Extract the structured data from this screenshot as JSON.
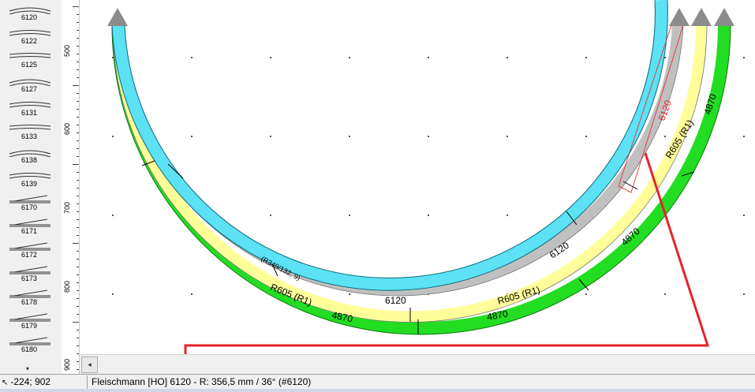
{
  "palette": {
    "items": [
      "6120",
      "6122",
      "6125",
      "6127",
      "6131",
      "6133",
      "6138",
      "6139",
      "6170",
      "6171",
      "6172",
      "6173",
      "6178",
      "6179",
      "6180"
    ]
  },
  "ruler": {
    "labels": [
      "500",
      "600",
      "700",
      "800",
      "900"
    ]
  },
  "canvas": {
    "labels": {
      "inner_track": "(R349/132, 9)",
      "gray_track_top": "6120",
      "gray_track_bottom": "6120",
      "gray_track_mid": "6120",
      "yellow_track_left": "R605 (R1)",
      "yellow_track_right": "R605 (R1)",
      "yellow_track_top": "R605 (R1)",
      "green_track_left": "4870",
      "green_track_bottom": "4870",
      "green_track_mid": "4870",
      "green_track_top": "4870"
    },
    "colors": {
      "cyan": "#5ce1f5",
      "gray": "#c0c0c0",
      "yellow": "#ffff99",
      "green": "#22dd22",
      "arrow": "#8c8c8c",
      "annotation": "#e8232a"
    }
  },
  "hscroll": {
    "left_arrow": "◂"
  },
  "status": {
    "coords": "-224; 902",
    "info": "Fleischmann [HO] 6120 - R: 356,5 mm / 36° (#6120)"
  }
}
